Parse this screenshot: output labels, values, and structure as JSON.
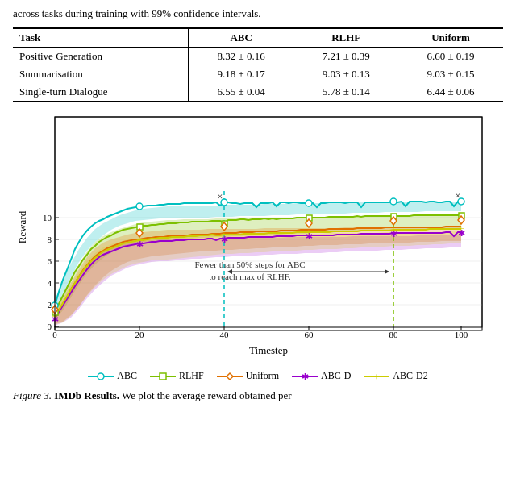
{
  "intro": {
    "text": "across tasks during training with 99% confidence intervals."
  },
  "table": {
    "headers": [
      "Task",
      "ABC",
      "RLHF",
      "Uniform"
    ],
    "rows": [
      {
        "task": "Positive Generation",
        "abc": "8.32 ± 0.16",
        "rlhf": "7.21 ± 0.39",
        "uniform": "6.60 ± 0.19"
      },
      {
        "task": "Summarisation",
        "abc": "9.18 ± 0.17",
        "rlhf": "9.03 ± 0.13",
        "uniform": "9.03 ± 0.15"
      },
      {
        "task": "Single-turn Dialogue",
        "abc": "6.55 ± 0.04",
        "rlhf": "5.78 ± 0.14",
        "uniform": "6.44 ± 0.06"
      }
    ]
  },
  "chart": {
    "x_label": "Timestep",
    "y_label": "Reward",
    "annotation": "Fewer than 50% steps for ABC\nto reach max of RLHF."
  },
  "legend": {
    "items": [
      {
        "label": "ABC",
        "color": "#00bfbf",
        "marker": "○"
      },
      {
        "label": "RLHF",
        "color": "#7dc000",
        "marker": "□"
      },
      {
        "label": "Uniform",
        "color": "#e07000",
        "marker": "◇"
      },
      {
        "label": "ABC-D",
        "color": "#9900cc",
        "marker": "✕"
      },
      {
        "label": "ABC-D2",
        "color": "#cccc00",
        "marker": "+"
      }
    ]
  },
  "caption": {
    "figure_num": "Figure 3.",
    "bold_part": "IMDb Results.",
    "text": " We plot the average reward obtained per"
  }
}
